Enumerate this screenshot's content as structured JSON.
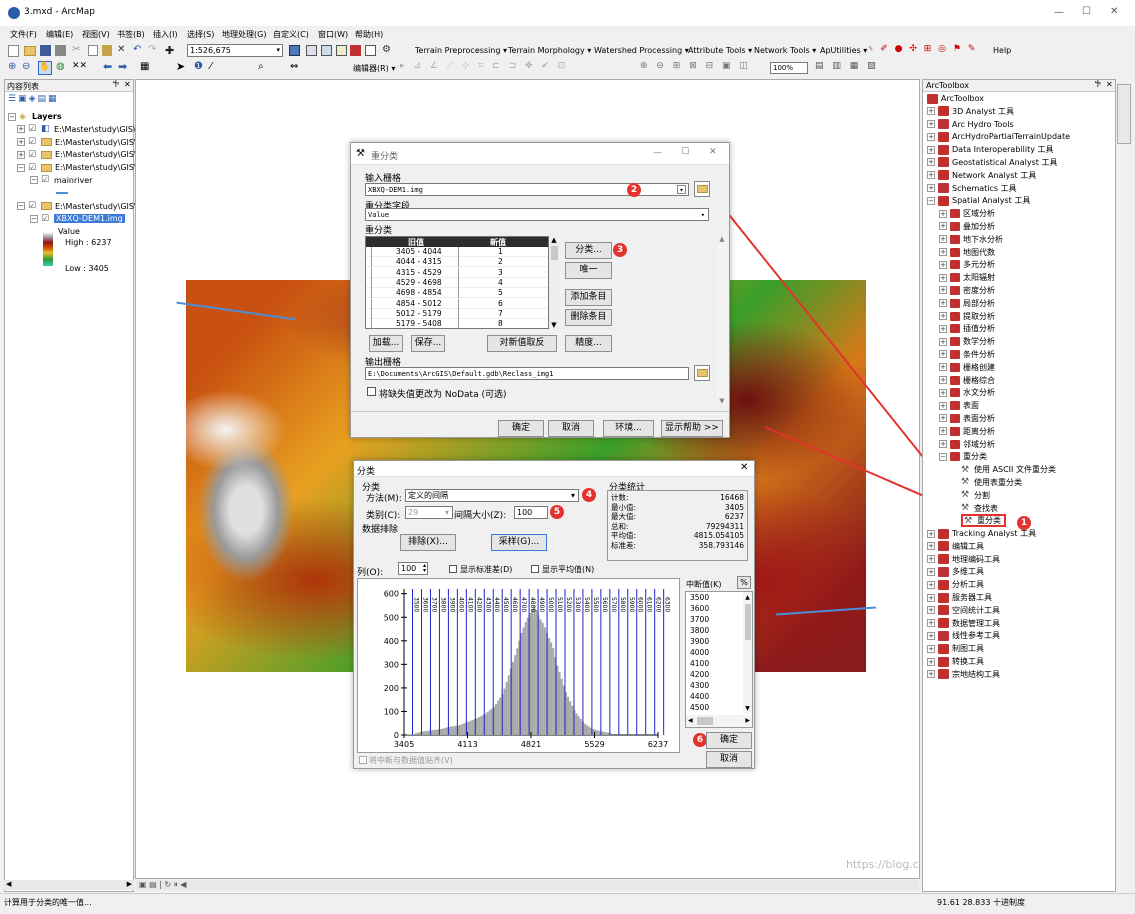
{
  "window": {
    "title": "3.mxd - ArcMap",
    "controls": [
      "—",
      "☐",
      "✕"
    ]
  },
  "menu": [
    "文件(F)",
    "编辑(E)",
    "视图(V)",
    "书签(B)",
    "插入(I)",
    "选择(S)",
    "地理处理(G)",
    "自定义(C)",
    "窗口(W)",
    "帮助(H)"
  ],
  "toolbar": {
    "scale": "1:526,675",
    "tools": [
      "Terrain Preprocessing ▾",
      "Terrain Morphology ▾",
      "Watershed Processing ▾",
      "Attribute Tools ▾",
      "Network Tools ▾",
      "ApUtilities ▾"
    ],
    "help": "Help",
    "editor": "编辑器(R) ▾",
    "zoom": "100%"
  },
  "toc": {
    "title": "内容列表",
    "layers_label": "Layers",
    "items": [
      "E:\\Master\\study\\GIS\\3.",
      "E:\\Master\\study\\GIS\\辅",
      "E:\\Master\\study\\GIS\\La",
      "E:\\Master\\study\\GIS\\辅",
      "mainriver",
      "E:\\Master\\study\\GIS\\辅",
      "XBXQ-DEM1.img"
    ],
    "legend": {
      "field": "Value",
      "high": "High : 6237",
      "low": "Low : 3405"
    }
  },
  "toolbox": {
    "title": "ArcToolbox",
    "root": "ArcToolbox",
    "items": [
      "3D Analyst 工具",
      "Arc Hydro Tools",
      "ArcHydroPartialTerrainUpdate",
      "Data Interoperability 工具",
      "Geostatistical Analyst 工具",
      "Network Analyst 工具",
      "Schematics 工具",
      "Spatial Analyst 工具"
    ],
    "spatial": [
      "区域分析",
      "叠加分析",
      "地下水分析",
      "地图代数",
      "多元分析",
      "太阳辐射",
      "密度分析",
      "局部分析",
      "提取分析",
      "插值分析",
      "数学分析",
      "条件分析",
      "栅格创建",
      "栅格综合",
      "水文分析",
      "表面",
      "表面分析",
      "距离分析",
      "邻域分析",
      "重分类"
    ],
    "reclass": [
      "使用 ASCII 文件重分类",
      "使用表重分类",
      "分割",
      "查找表",
      "重分类"
    ],
    "after": [
      "Tracking Analyst 工具",
      "编辑工具",
      "地理编码工具",
      "多维工具",
      "分析工具",
      "服务器工具",
      "空间统计工具",
      "数据管理工具",
      "线性参考工具",
      "制图工具",
      "转换工具",
      "宗地结构工具"
    ]
  },
  "reclass_dialog": {
    "title": "重分类",
    "input_label": "输入栅格",
    "input_value": "XBXQ-DEM1.img",
    "field_label": "重分类字段",
    "field_value": "Value",
    "reclass_label": "重分类",
    "col_old": "旧值",
    "col_new": "新值",
    "rows": [
      [
        "3405 - 4044",
        "1"
      ],
      [
        "4044 - 4315",
        "2"
      ],
      [
        "4315 - 4529",
        "3"
      ],
      [
        "4529 - 4698",
        "4"
      ],
      [
        "4698 - 4854",
        "5"
      ],
      [
        "4854 - 5012",
        "6"
      ],
      [
        "5012 - 5179",
        "7"
      ],
      [
        "5179 - 5408",
        "8"
      ]
    ],
    "btn_classify": "分类...",
    "btn_unique": "唯一",
    "btn_add": "添加条目",
    "btn_delete": "删除条目",
    "btn_load": "加载...",
    "btn_save": "保存...",
    "btn_reverse": "对新值取反",
    "btn_precision": "精度...",
    "output_label": "输出栅格",
    "output_value": "E:\\Documents\\ArcGIS\\Default.gdb\\Reclass_img1",
    "nodata": "将缺失值更改为 NoData (可选)",
    "btn_ok": "确定",
    "btn_cancel": "取消",
    "btn_env": "环境...",
    "btn_help": "显示帮助 >>"
  },
  "classify_dialog": {
    "title": "分类",
    "group_class": "分类",
    "method_label": "方法(M):",
    "method_value": "定义的间隔",
    "classes_label": "类别(C):",
    "classes_value": "29",
    "interval_label": "间隔大小(Z):",
    "interval_value": "100",
    "exclusion": "数据排除",
    "btn_exclude": "排除(X)...",
    "btn_sample": "采样(G)...",
    "stats_title": "分类统计",
    "stats": [
      [
        "计数:",
        "16468"
      ],
      [
        "最小值:",
        "3405"
      ],
      [
        "最大值:",
        "6237"
      ],
      [
        "总和:",
        "79294311"
      ],
      [
        "平均值:",
        "4815.054105"
      ],
      [
        "标准差:",
        "358.793146"
      ]
    ],
    "col_label": "列(O):",
    "col_value": "100",
    "show_std": "显示标准差(D)",
    "show_mean": "显示平均值(N)",
    "break_label": "中断值(K)",
    "pct": "%",
    "breaks": [
      "3500",
      "3600",
      "3700",
      "3800",
      "3900",
      "4000",
      "4100",
      "4200",
      "4300",
      "4400",
      "4500"
    ],
    "snap": "将中断与数据值贴齐(V)",
    "btn_ok": "确定",
    "btn_cancel": "取消"
  },
  "chart_data": {
    "type": "bar",
    "title": "",
    "xlabel": "",
    "ylabel": "",
    "x_ticks": [
      "3405",
      "4113",
      "4821",
      "5529",
      "6237"
    ],
    "y_ticks": [
      "0",
      "100",
      "200",
      "300",
      "400",
      "500",
      "600"
    ],
    "ylim": [
      0,
      620
    ],
    "xlim": [
      3405,
      6237
    ],
    "breaks": [
      3500,
      3600,
      3700,
      3800,
      3900,
      4000,
      4100,
      4200,
      4300,
      4400,
      4500,
      4600,
      4700,
      4800,
      4900,
      5000,
      5100,
      5200,
      5300,
      5400,
      5500,
      5600,
      5700,
      5800,
      5900,
      6000,
      6100,
      6200,
      6300
    ],
    "hist_x": [
      3500,
      3600,
      3700,
      3800,
      3900,
      4000,
      4100,
      4200,
      4300,
      4400,
      4500,
      4600,
      4650,
      4700,
      4750,
      4800,
      4850,
      4900,
      4950,
      5000,
      5050,
      5100,
      5150,
      5200,
      5300,
      5400,
      5500,
      5600,
      5700
    ],
    "hist_y": [
      5,
      15,
      20,
      25,
      35,
      40,
      55,
      70,
      90,
      120,
      180,
      300,
      360,
      430,
      480,
      520,
      550,
      500,
      470,
      420,
      380,
      300,
      240,
      180,
      100,
      50,
      25,
      15,
      8
    ]
  },
  "map": {
    "coords": "91.61  28.833 十进制度",
    "watermark": "https://blog.csdn.net/weixin_45012724"
  },
  "status": "计算用于分类的唯一值...",
  "annotations": {
    "c1": "1",
    "c2": "2",
    "c3": "3",
    "c4": "4",
    "c5": "5",
    "c6": "6"
  }
}
